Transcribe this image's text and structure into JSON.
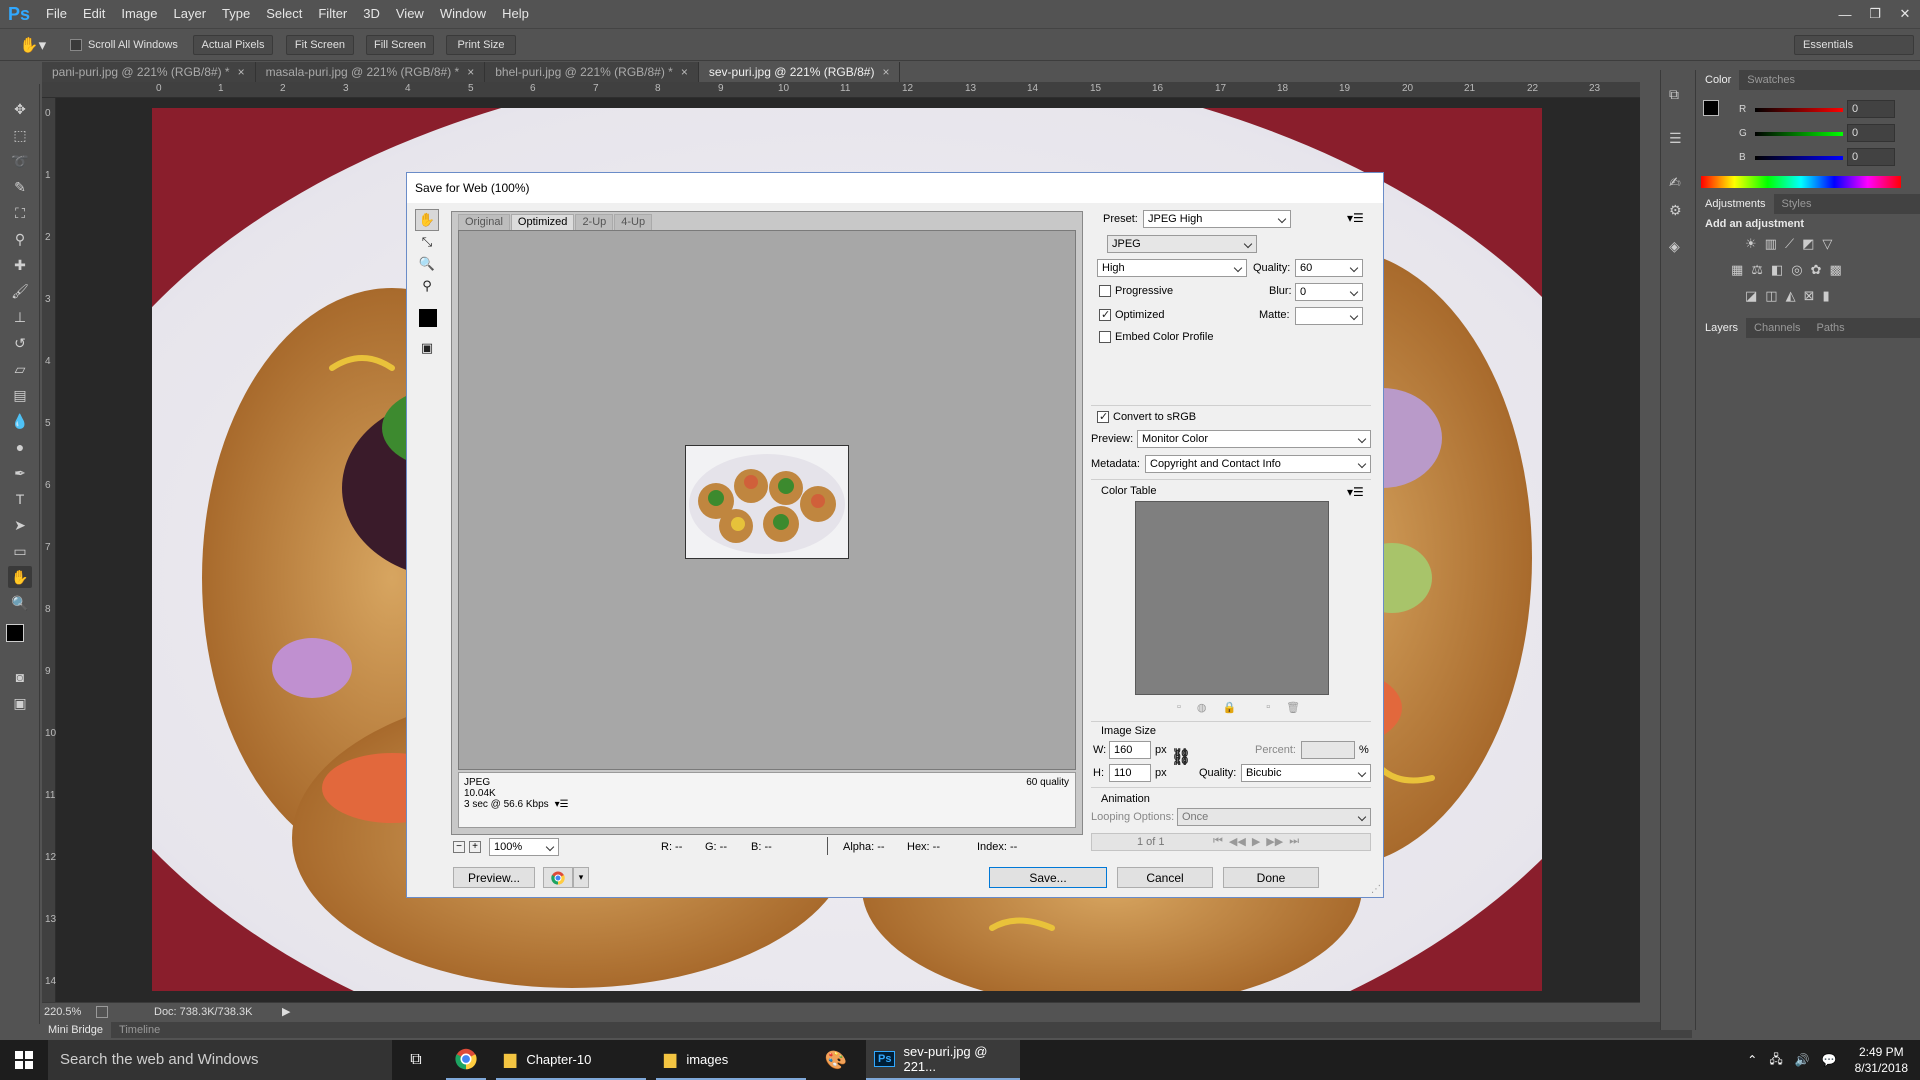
{
  "app": {
    "logo": "Ps"
  },
  "menu": [
    "File",
    "Edit",
    "Image",
    "Layer",
    "Type",
    "Select",
    "Filter",
    "3D",
    "View",
    "Window",
    "Help"
  ],
  "window_controls": {
    "minimize": "—",
    "restore": "❐",
    "close": "✕"
  },
  "options": {
    "scroll_all_windows": "Scroll All Windows",
    "actual_pixels": "Actual Pixels",
    "fit_screen": "Fit Screen",
    "fill_screen": "Fill Screen",
    "print_size": "Print Size",
    "workspace": "Essentials"
  },
  "tabs": [
    {
      "label": "pani-puri.jpg @ 221% (RGB/8#) *"
    },
    {
      "label": "masala-puri.jpg @ 221% (RGB/8#) *"
    },
    {
      "label": "bhel-puri.jpg @ 221% (RGB/8#) *"
    },
    {
      "label": "sev-puri.jpg @ 221% (RGB/8#)"
    }
  ],
  "ruler_top": [
    "0",
    "1",
    "2",
    "3",
    "4",
    "5",
    "6",
    "7",
    "8",
    "9",
    "10",
    "11",
    "12",
    "13",
    "14",
    "15",
    "16",
    "17",
    "18",
    "19",
    "20",
    "21",
    "22",
    "23"
  ],
  "ruler_left": [
    "0",
    "1",
    "2",
    "3",
    "4",
    "5",
    "6",
    "7",
    "8",
    "9",
    "10",
    "11",
    "12",
    "13",
    "14"
  ],
  "status": {
    "zoom": "220.5%",
    "doc": "Doc: 738.3K/738.3K"
  },
  "bottom_tabs": [
    "Mini Bridge",
    "Timeline"
  ],
  "panels": {
    "color_tabs": [
      "Color",
      "Swatches"
    ],
    "r_label": "R",
    "g_label": "G",
    "b_label": "B",
    "r_value": "0",
    "g_value": "0",
    "b_value": "0",
    "adj_tabs": [
      "Adjustments",
      "Styles"
    ],
    "adj_title": "Add an adjustment",
    "layer_tabs": [
      "Layers",
      "Channels",
      "Paths"
    ]
  },
  "dialog": {
    "title": "Save for Web (100%)",
    "view_tabs": [
      "Original",
      "Optimized",
      "2-Up",
      "4-Up"
    ],
    "info_format": "JPEG",
    "info_size": "10.04K",
    "info_time": "3 sec @ 56.6 Kbps",
    "info_quality": "60 quality",
    "zoom_value": "100%",
    "readout": {
      "r": "R: --",
      "g": "G: --",
      "b": "B: --",
      "alpha": "Alpha: --",
      "hex": "Hex: --",
      "index": "Index: --"
    },
    "preview_button": "Preview...",
    "preset_label": "Preset:",
    "preset_value": "JPEG High",
    "format_value": "JPEG",
    "quality_level": "High",
    "quality_label": "Quality:",
    "quality_value": "60",
    "progressive_label": "Progressive",
    "blur_label": "Blur:",
    "blur_value": "0",
    "optimized_label": "Optimized",
    "matte_label": "Matte:",
    "embed_label": "Embed Color Profile",
    "convert_label": "Convert to sRGB",
    "preview_label": "Preview:",
    "preview_value": "Monitor Color",
    "metadata_label": "Metadata:",
    "metadata_value": "Copyright and Contact Info",
    "color_table_label": "Color Table",
    "image_size_label": "Image Size",
    "w_label": "W:",
    "w_value": "160",
    "h_label": "H:",
    "h_value": "110",
    "unit": "px",
    "percent_label": "Percent:",
    "percent_sign": "%",
    "resample_label": "Quality:",
    "resample_value": "Bicubic",
    "animation_label": "Animation",
    "looping_label": "Looping Options:",
    "looping_value": "Once",
    "frame_label": "1 of 1",
    "save_button": "Save...",
    "cancel_button": "Cancel",
    "done_button": "Done"
  },
  "taskbar": {
    "search_placeholder": "Search the web and Windows",
    "apps": [
      {
        "label": "Chapter-10"
      },
      {
        "label": "images"
      },
      {
        "label": "sev-puri.jpg @ 221..."
      }
    ],
    "time": "2:49 PM",
    "date": "8/31/2018"
  }
}
